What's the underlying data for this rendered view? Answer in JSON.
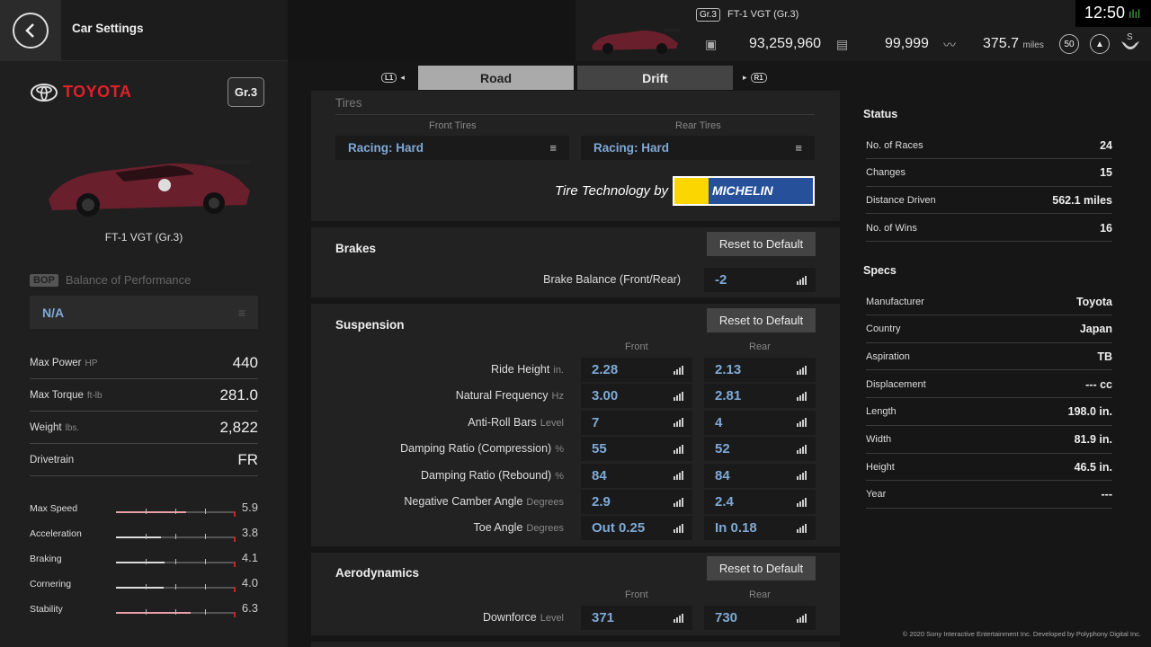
{
  "header": {
    "title": "Car Settings",
    "grade_badge": "Gr.3",
    "car_name": "FT-1 VGT (Gr.3)",
    "credits": "93,259,960",
    "mileage_points": "99,999",
    "distance": "375.7",
    "distance_unit": "miles",
    "level": "50",
    "clock": "12:50"
  },
  "left": {
    "brand": "TOYOTA",
    "group": "Gr.3",
    "car_name": "FT-1 VGT (Gr.3)",
    "bop_tag": "BOP",
    "bop_label": "Balance of Performance",
    "bop_value": "N/A",
    "specs": [
      {
        "label": "Max Power",
        "unit": "HP",
        "value": "440"
      },
      {
        "label": "Max Torque",
        "unit": "ft-lb",
        "value": "281.0"
      },
      {
        "label": "Weight",
        "unit": "lbs.",
        "value": "2,822"
      },
      {
        "label": "Drivetrain",
        "unit": "",
        "value": "FR"
      }
    ],
    "performance": [
      {
        "label": "Max Speed",
        "value": "5.9",
        "level": 0.59
      },
      {
        "label": "Acceleration",
        "value": "3.8",
        "level": 0.38
      },
      {
        "label": "Braking",
        "value": "4.1",
        "level": 0.41
      },
      {
        "label": "Cornering",
        "value": "4.0",
        "level": 0.4
      },
      {
        "label": "Stability",
        "value": "6.3",
        "level": 0.63
      }
    ]
  },
  "tabs": {
    "left_button": "L1",
    "right_button": "R1",
    "road": "Road",
    "drift": "Drift"
  },
  "tires": {
    "heading": "Tires",
    "front_label": "Front Tires",
    "rear_label": "Rear Tires",
    "front_value": "Racing: Hard",
    "rear_value": "Racing: Hard",
    "tech_text": "Tire Technology by",
    "brand": "MICHELIN"
  },
  "brakes": {
    "heading": "Brakes",
    "reset": "Reset to Default",
    "balance_label": "Brake Balance (Front/Rear)",
    "balance_value": "-2"
  },
  "suspension": {
    "heading": "Suspension",
    "reset": "Reset to Default",
    "front": "Front",
    "rear": "Rear",
    "rows": [
      {
        "label": "Ride Height",
        "unit": "in.",
        "front": "2.28",
        "rear": "2.13"
      },
      {
        "label": "Natural Frequency",
        "unit": "Hz",
        "front": "3.00",
        "rear": "2.81"
      },
      {
        "label": "Anti-Roll Bars",
        "unit": "Level",
        "front": "7",
        "rear": "4"
      },
      {
        "label": "Damping Ratio (Compression)",
        "unit": "%",
        "front": "55",
        "rear": "52"
      },
      {
        "label": "Damping Ratio (Rebound)",
        "unit": "%",
        "front": "84",
        "rear": "84"
      },
      {
        "label": "Negative Camber Angle",
        "unit": "Degrees",
        "front": "2.9",
        "rear": "2.4"
      },
      {
        "label": "Toe Angle",
        "unit": "Degrees",
        "front": "Out 0.25",
        "rear": "In 0.18"
      }
    ]
  },
  "aero": {
    "heading": "Aerodynamics",
    "reset": "Reset to Default",
    "front": "Front",
    "rear": "Rear",
    "downforce_label": "Downforce",
    "downforce_unit": "Level",
    "front_value": "371",
    "rear_value": "730"
  },
  "status": {
    "heading": "Status",
    "rows": [
      {
        "label": "No. of Races",
        "value": "24"
      },
      {
        "label": "Changes",
        "value": "15"
      },
      {
        "label": "Distance Driven",
        "value": "562.1 miles"
      },
      {
        "label": "No. of Wins",
        "value": "16"
      }
    ]
  },
  "specs": {
    "heading": "Specs",
    "rows": [
      {
        "label": "Manufacturer",
        "value": "Toyota"
      },
      {
        "label": "Country",
        "value": "Japan"
      },
      {
        "label": "Aspiration",
        "value": "TB"
      },
      {
        "label": "Displacement",
        "value": "--- cc"
      },
      {
        "label": "Length",
        "value": "198.0 in."
      },
      {
        "label": "Width",
        "value": "81.9 in."
      },
      {
        "label": "Height",
        "value": "46.5 in."
      },
      {
        "label": "Year",
        "value": "---"
      }
    ]
  },
  "footer": {
    "copyright": "© 2020 Sony Interactive Entertainment Inc. Developed by Polyphony Digital Inc."
  },
  "colors": {
    "accent_value": "#7fa9d6",
    "brand_red": "#e0202a"
  }
}
